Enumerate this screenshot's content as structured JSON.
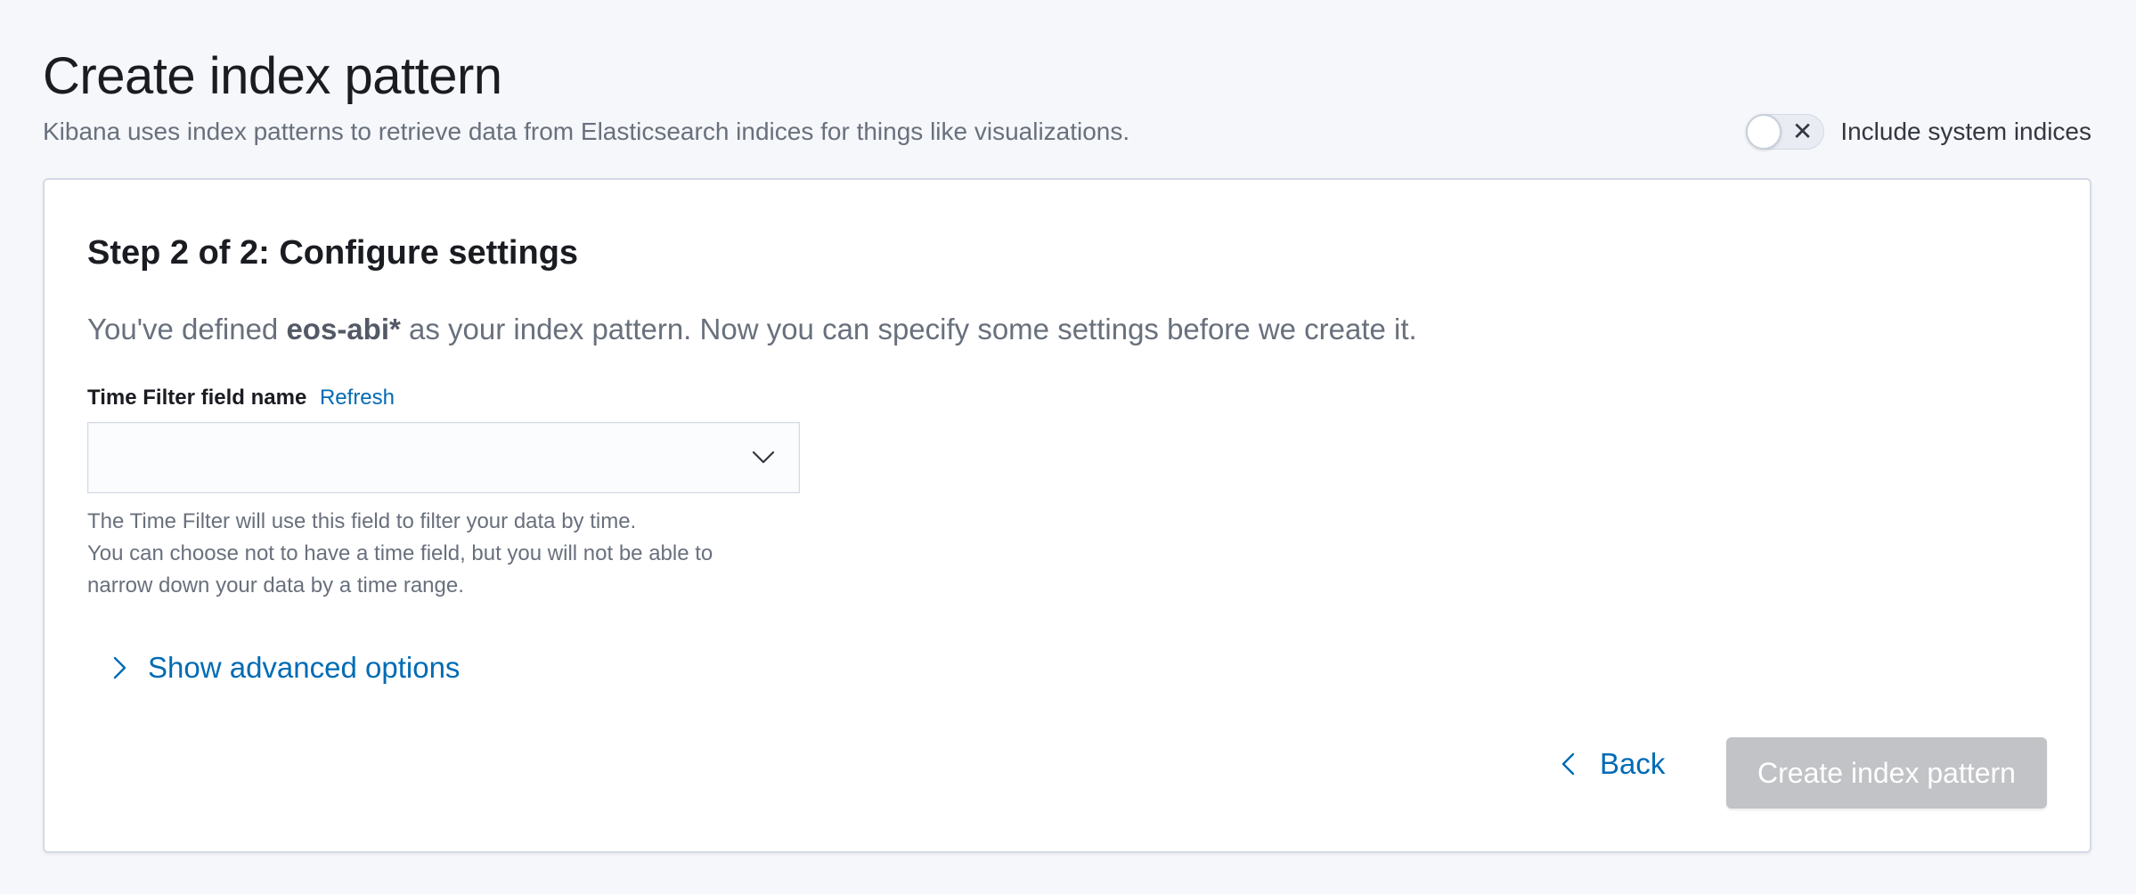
{
  "header": {
    "title": "Create index pattern",
    "subtitle": "Kibana uses index patterns to retrieve data from Elasticsearch indices for things like visualizations."
  },
  "system_indices_toggle": {
    "label": "Include system indices",
    "checked": false,
    "off_glyph": "✕"
  },
  "step": {
    "title": "Step 2 of 2: Configure settings",
    "description_prefix": "You've defined ",
    "pattern": "eos-abi*",
    "description_suffix": " as your index pattern. Now you can specify some settings before we create it."
  },
  "time_filter": {
    "label": "Time Filter field name",
    "refresh_label": "Refresh",
    "selected_value": "",
    "help_lines": [
      "The Time Filter will use this field to filter your data by time.",
      "You can choose not to have a time field, but you will not be able to",
      "narrow down your data by a time range."
    ]
  },
  "advanced": {
    "label": "Show advanced options",
    "icon": "chevron-right-icon"
  },
  "actions": {
    "back_label": "Back",
    "create_label": "Create index pattern",
    "create_disabled": true
  },
  "colors": {
    "link": "#006bb4",
    "disabled_button": "#c2c3c6",
    "background": "#f5f7fa",
    "panel_border": "#d3dae6"
  }
}
